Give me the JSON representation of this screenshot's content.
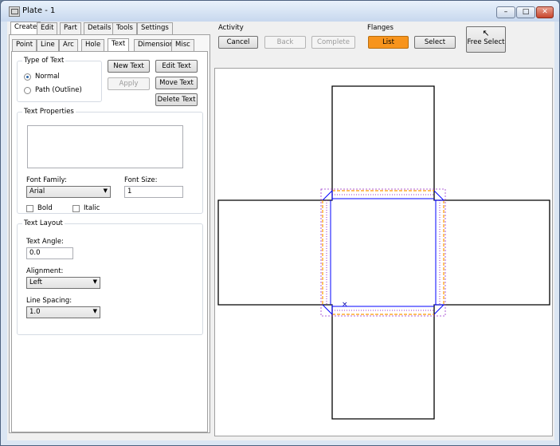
{
  "window": {
    "title": "Plate - 1"
  },
  "main_tabs": [
    "Create",
    "Edit",
    "Part",
    "Details",
    "Tools",
    "Settings"
  ],
  "sub_tabs": [
    "Point",
    "Line",
    "Arc",
    "Hole",
    "Text",
    "Dimension",
    "Misc"
  ],
  "type_of_text": {
    "title": "Type of Text",
    "normal": "Normal",
    "path": "Path (Outline)"
  },
  "text_buttons": {
    "new_text": "New Text",
    "edit_text": "Edit Text",
    "apply": "Apply",
    "move_text": "Move Text",
    "delete_text": "Delete Text"
  },
  "text_properties": {
    "title": "Text Properties",
    "font_family_label": "Font Family:",
    "font_family_value": "Arial",
    "font_size_label": "Font Size:",
    "font_size_value": "1",
    "bold": "Bold",
    "italic": "Italic"
  },
  "text_layout": {
    "title": "Text Layout",
    "angle_label": "Text Angle:",
    "angle_value": "0.0",
    "alignment_label": "Alignment:",
    "alignment_value": "Left",
    "spacing_label": "Line Spacing:",
    "spacing_value": "1.0"
  },
  "activity": {
    "title": "Activity",
    "cancel": "Cancel",
    "back": "Back",
    "complete": "Complete"
  },
  "flanges": {
    "title": "Flanges",
    "list": "List",
    "select": "Select"
  },
  "free_select": {
    "label": "Free Select"
  },
  "colors": {
    "accent": "#f7941d",
    "outline": "#000000",
    "bend_blue": "#0000ff",
    "dash_orange": "#ff9900",
    "dash_purple": "#9933cc"
  }
}
